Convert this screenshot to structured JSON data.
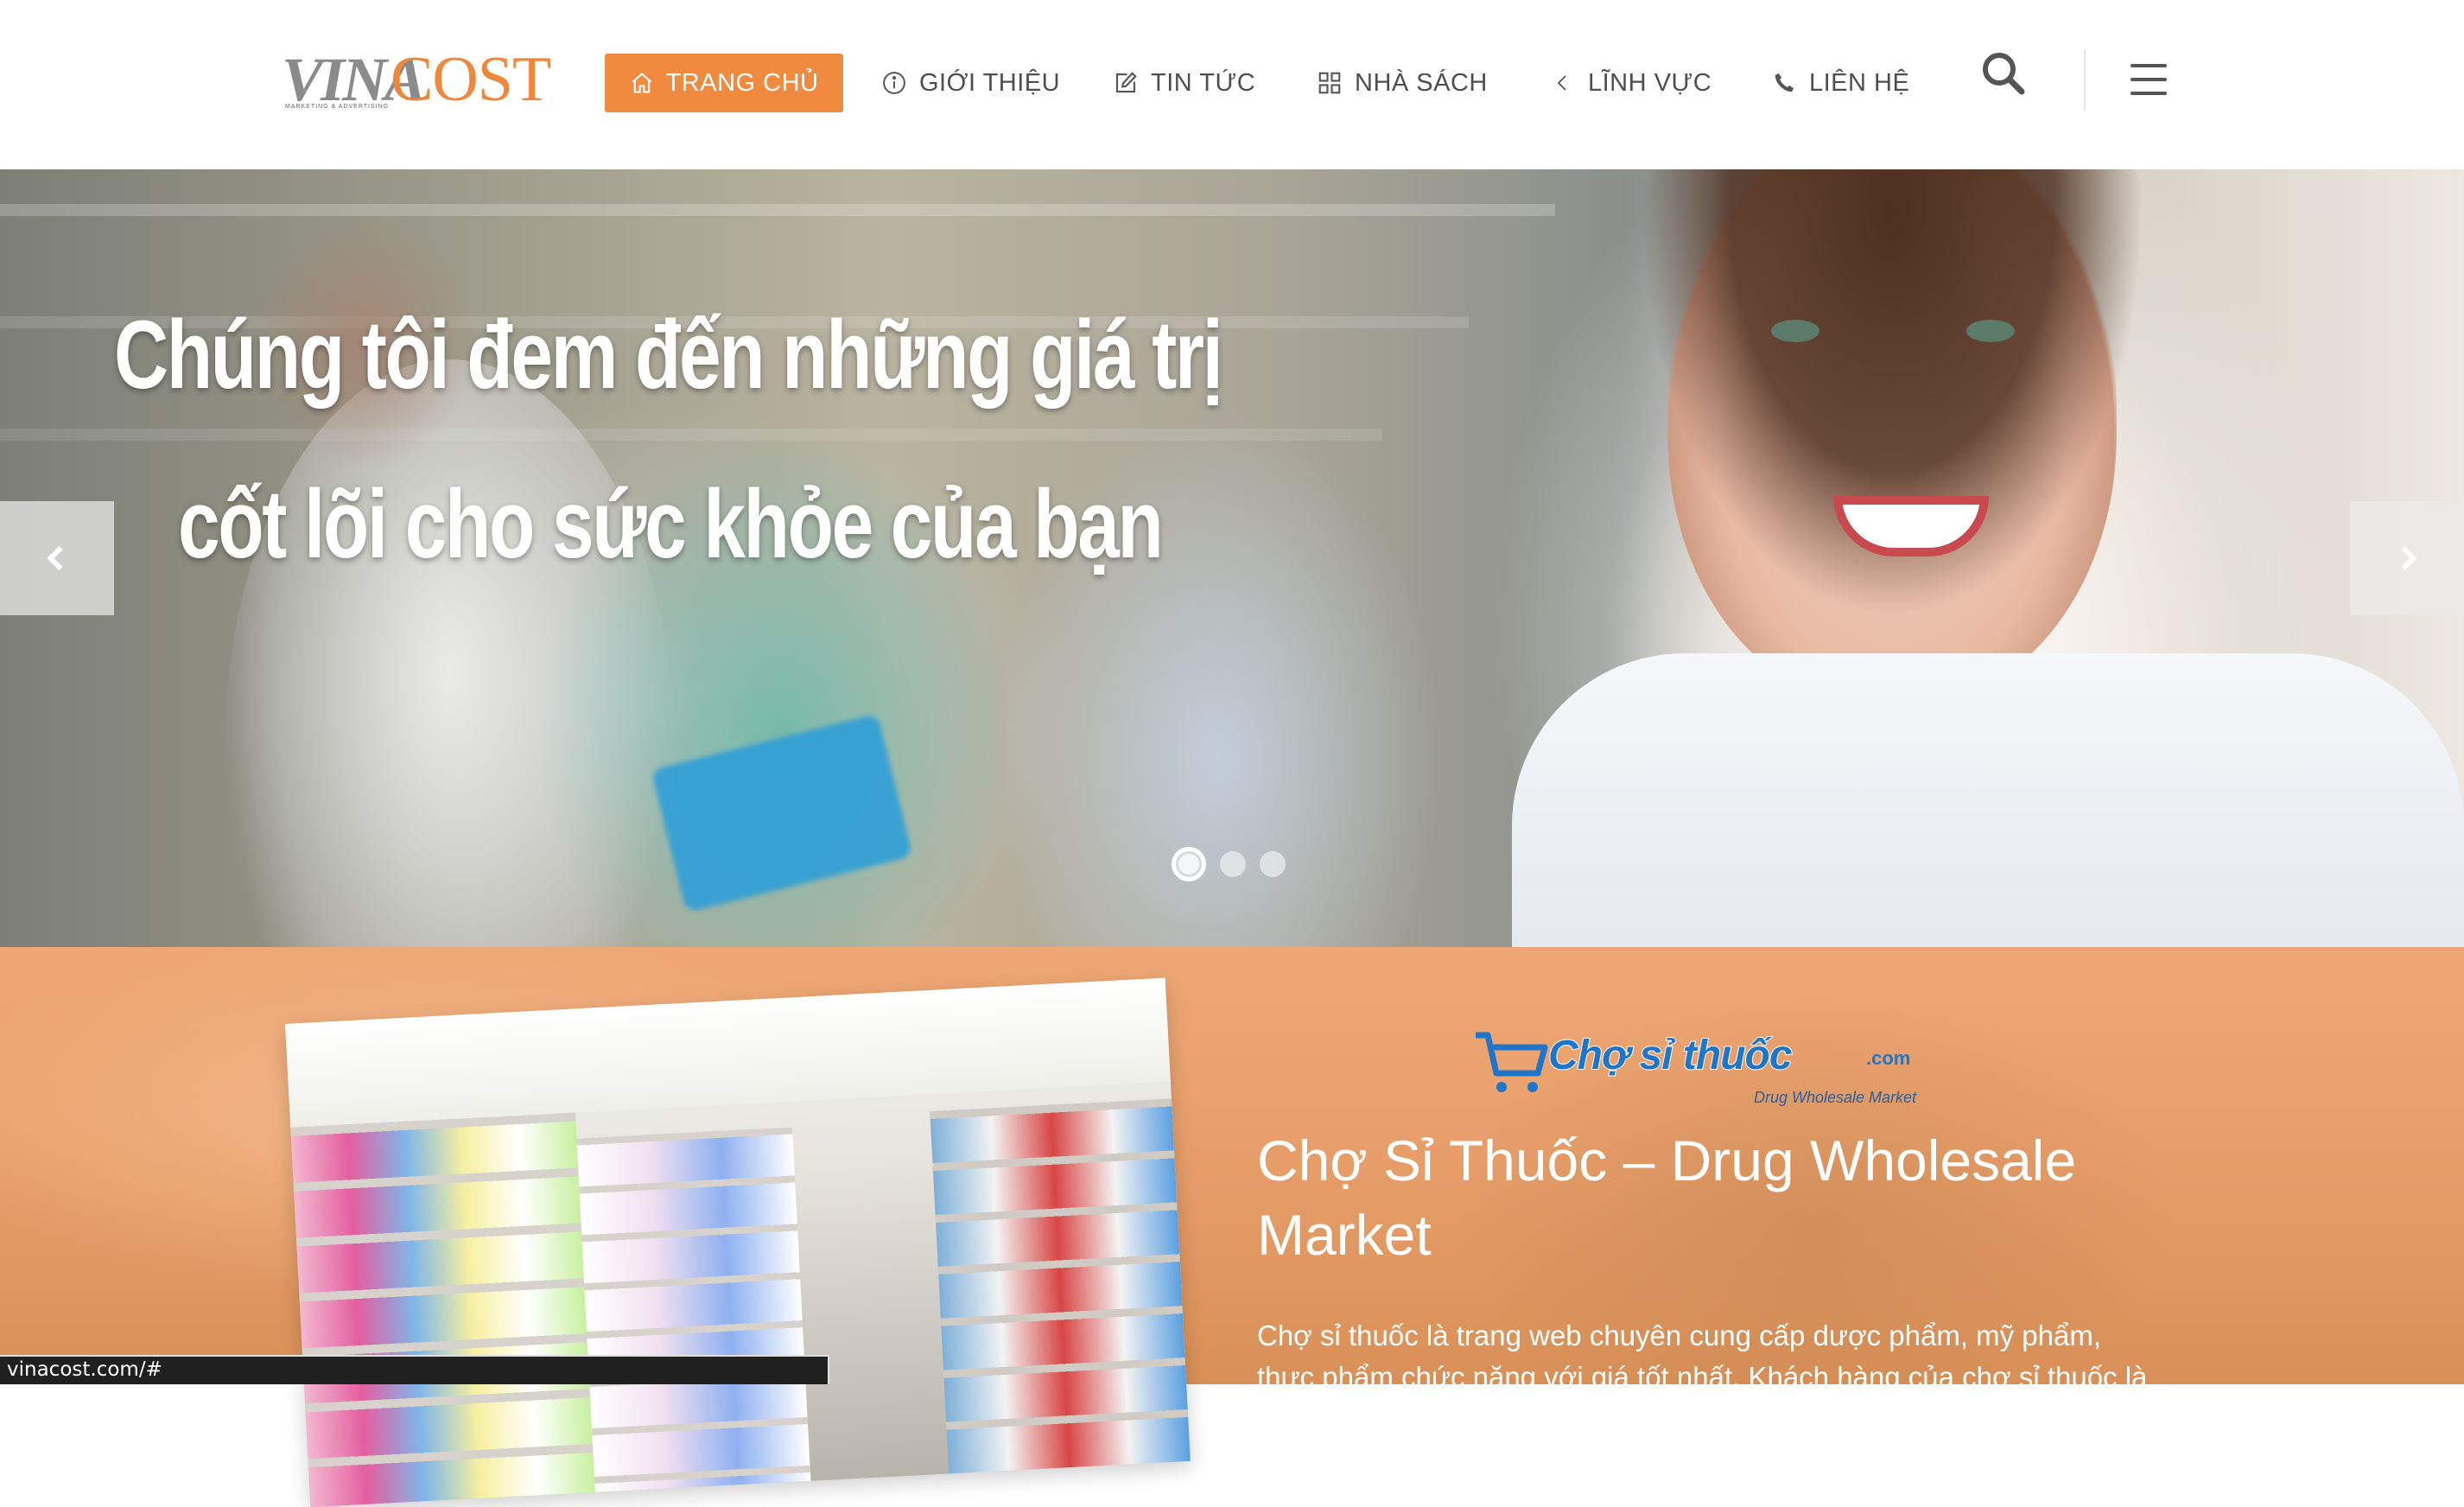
{
  "logo": {
    "brand_part1": "VINA",
    "brand_part2": "COST",
    "tagline": "MARKETING & ADVERTISING"
  },
  "nav": {
    "items": [
      {
        "label": "TRANG CHỦ",
        "icon": "home-icon",
        "active": true
      },
      {
        "label": "GIỚI THIỆU",
        "icon": "info-icon",
        "active": false
      },
      {
        "label": "TIN TỨC",
        "icon": "edit-icon",
        "active": false
      },
      {
        "label": "NHÀ SÁCH",
        "icon": "grid-icon",
        "active": false
      },
      {
        "label": "LĨNH VỰC",
        "icon": "chevron-left-icon",
        "active": false
      },
      {
        "label": "LIÊN HỆ",
        "icon": "phone-icon",
        "active": false
      }
    ],
    "search_icon": "search-icon",
    "menu_icon": "hamburger-icon"
  },
  "hero": {
    "line1": "Chúng tôi đem đến những giá trị",
    "line2": "cốt lõi cho sức khỏe của bạn",
    "slides_total": 3,
    "active_slide": 1
  },
  "section": {
    "brand_logo_text": "Chợ sỉ thuốc",
    "brand_logo_suffix": ".com",
    "brand_logo_sub": "Drug Wholesale Market",
    "title": "Chợ Sỉ Thuốc – Drug Wholesale Market",
    "description": "Chợ sỉ thuốc là trang web chuyên cung cấp dược phẩm, mỹ phẩm, thực phẩm chức năng với giá tốt nhất. Khách hàng của chợ sỉ thuốc là nhà"
  },
  "status_bar": {
    "url": "vinacost.com/#"
  },
  "colors": {
    "accent": "#f08a3f",
    "nav_text": "#4e4e4e",
    "section_bg": "#eca26e",
    "brand_blue": "#1f76c9"
  }
}
